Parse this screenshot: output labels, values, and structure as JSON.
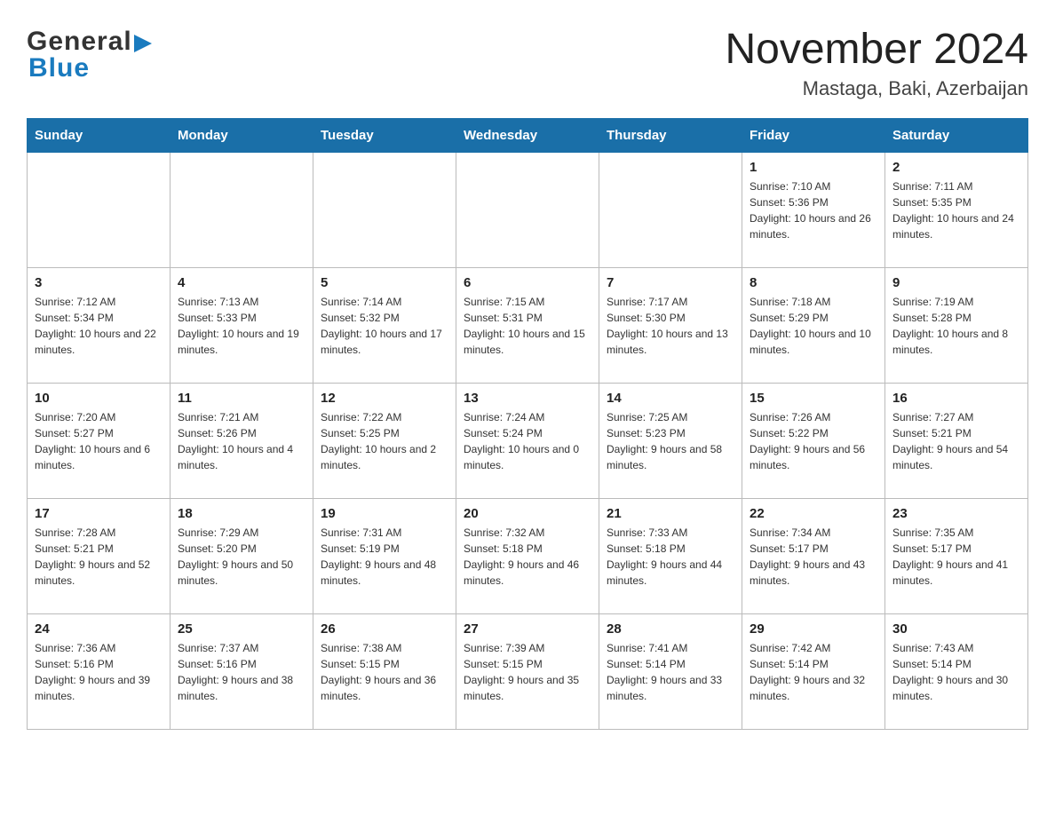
{
  "header": {
    "logo_general": "General",
    "logo_blue": "Blue",
    "month_title": "November 2024",
    "location": "Mastaga, Baki, Azerbaijan"
  },
  "days_of_week": [
    "Sunday",
    "Monday",
    "Tuesday",
    "Wednesday",
    "Thursday",
    "Friday",
    "Saturday"
  ],
  "weeks": [
    [
      {
        "day": "",
        "info": ""
      },
      {
        "day": "",
        "info": ""
      },
      {
        "day": "",
        "info": ""
      },
      {
        "day": "",
        "info": ""
      },
      {
        "day": "",
        "info": ""
      },
      {
        "day": "1",
        "info": "Sunrise: 7:10 AM\nSunset: 5:36 PM\nDaylight: 10 hours and 26 minutes."
      },
      {
        "day": "2",
        "info": "Sunrise: 7:11 AM\nSunset: 5:35 PM\nDaylight: 10 hours and 24 minutes."
      }
    ],
    [
      {
        "day": "3",
        "info": "Sunrise: 7:12 AM\nSunset: 5:34 PM\nDaylight: 10 hours and 22 minutes."
      },
      {
        "day": "4",
        "info": "Sunrise: 7:13 AM\nSunset: 5:33 PM\nDaylight: 10 hours and 19 minutes."
      },
      {
        "day": "5",
        "info": "Sunrise: 7:14 AM\nSunset: 5:32 PM\nDaylight: 10 hours and 17 minutes."
      },
      {
        "day": "6",
        "info": "Sunrise: 7:15 AM\nSunset: 5:31 PM\nDaylight: 10 hours and 15 minutes."
      },
      {
        "day": "7",
        "info": "Sunrise: 7:17 AM\nSunset: 5:30 PM\nDaylight: 10 hours and 13 minutes."
      },
      {
        "day": "8",
        "info": "Sunrise: 7:18 AM\nSunset: 5:29 PM\nDaylight: 10 hours and 10 minutes."
      },
      {
        "day": "9",
        "info": "Sunrise: 7:19 AM\nSunset: 5:28 PM\nDaylight: 10 hours and 8 minutes."
      }
    ],
    [
      {
        "day": "10",
        "info": "Sunrise: 7:20 AM\nSunset: 5:27 PM\nDaylight: 10 hours and 6 minutes."
      },
      {
        "day": "11",
        "info": "Sunrise: 7:21 AM\nSunset: 5:26 PM\nDaylight: 10 hours and 4 minutes."
      },
      {
        "day": "12",
        "info": "Sunrise: 7:22 AM\nSunset: 5:25 PM\nDaylight: 10 hours and 2 minutes."
      },
      {
        "day": "13",
        "info": "Sunrise: 7:24 AM\nSunset: 5:24 PM\nDaylight: 10 hours and 0 minutes."
      },
      {
        "day": "14",
        "info": "Sunrise: 7:25 AM\nSunset: 5:23 PM\nDaylight: 9 hours and 58 minutes."
      },
      {
        "day": "15",
        "info": "Sunrise: 7:26 AM\nSunset: 5:22 PM\nDaylight: 9 hours and 56 minutes."
      },
      {
        "day": "16",
        "info": "Sunrise: 7:27 AM\nSunset: 5:21 PM\nDaylight: 9 hours and 54 minutes."
      }
    ],
    [
      {
        "day": "17",
        "info": "Sunrise: 7:28 AM\nSunset: 5:21 PM\nDaylight: 9 hours and 52 minutes."
      },
      {
        "day": "18",
        "info": "Sunrise: 7:29 AM\nSunset: 5:20 PM\nDaylight: 9 hours and 50 minutes."
      },
      {
        "day": "19",
        "info": "Sunrise: 7:31 AM\nSunset: 5:19 PM\nDaylight: 9 hours and 48 minutes."
      },
      {
        "day": "20",
        "info": "Sunrise: 7:32 AM\nSunset: 5:18 PM\nDaylight: 9 hours and 46 minutes."
      },
      {
        "day": "21",
        "info": "Sunrise: 7:33 AM\nSunset: 5:18 PM\nDaylight: 9 hours and 44 minutes."
      },
      {
        "day": "22",
        "info": "Sunrise: 7:34 AM\nSunset: 5:17 PM\nDaylight: 9 hours and 43 minutes."
      },
      {
        "day": "23",
        "info": "Sunrise: 7:35 AM\nSunset: 5:17 PM\nDaylight: 9 hours and 41 minutes."
      }
    ],
    [
      {
        "day": "24",
        "info": "Sunrise: 7:36 AM\nSunset: 5:16 PM\nDaylight: 9 hours and 39 minutes."
      },
      {
        "day": "25",
        "info": "Sunrise: 7:37 AM\nSunset: 5:16 PM\nDaylight: 9 hours and 38 minutes."
      },
      {
        "day": "26",
        "info": "Sunrise: 7:38 AM\nSunset: 5:15 PM\nDaylight: 9 hours and 36 minutes."
      },
      {
        "day": "27",
        "info": "Sunrise: 7:39 AM\nSunset: 5:15 PM\nDaylight: 9 hours and 35 minutes."
      },
      {
        "day": "28",
        "info": "Sunrise: 7:41 AM\nSunset: 5:14 PM\nDaylight: 9 hours and 33 minutes."
      },
      {
        "day": "29",
        "info": "Sunrise: 7:42 AM\nSunset: 5:14 PM\nDaylight: 9 hours and 32 minutes."
      },
      {
        "day": "30",
        "info": "Sunrise: 7:43 AM\nSunset: 5:14 PM\nDaylight: 9 hours and 30 minutes."
      }
    ]
  ]
}
